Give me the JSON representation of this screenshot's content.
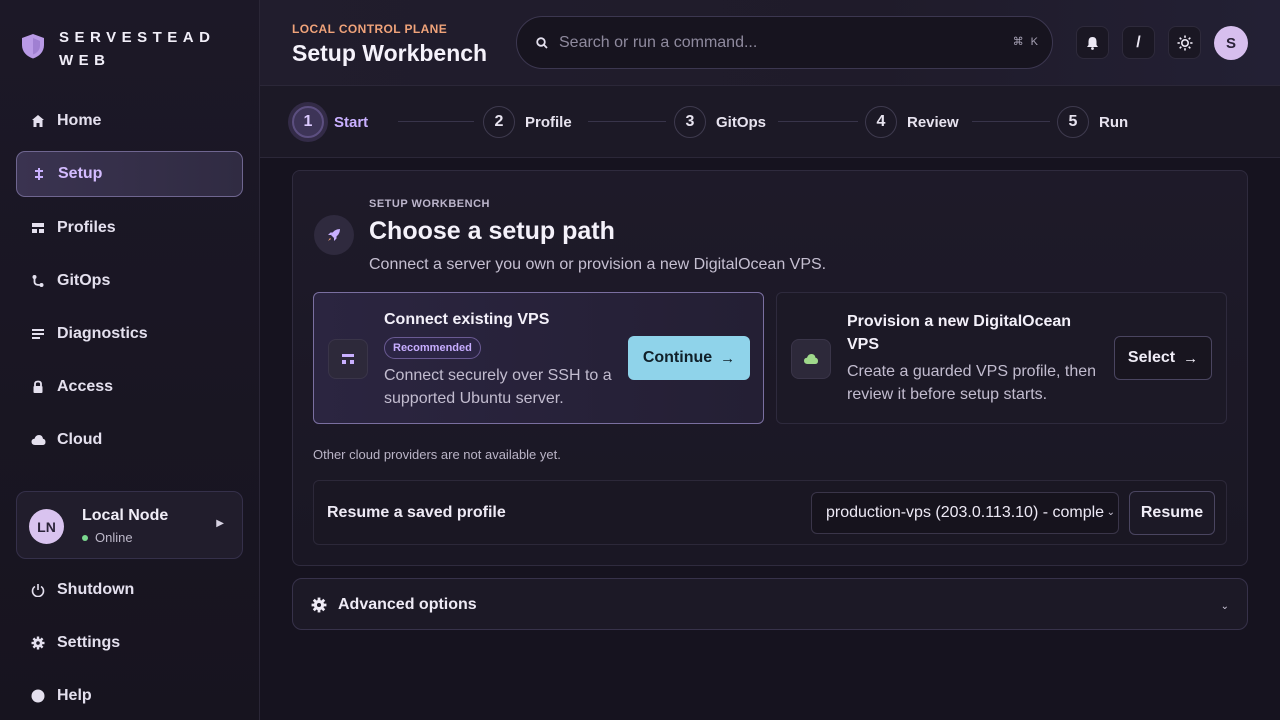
{
  "brand": {
    "name": "SERVESTEAD WEB",
    "logo_icon": "shield-logo-icon"
  },
  "sidebar": {
    "items": [
      {
        "label": "Home",
        "icon": "home-icon"
      },
      {
        "label": "Setup",
        "icon": "setup-icon",
        "active": true
      },
      {
        "label": "Profiles",
        "icon": "profiles-icon"
      },
      {
        "label": "GitOps",
        "icon": "gitops-icon"
      },
      {
        "label": "Diagnostics",
        "icon": "diagnostics-icon"
      },
      {
        "label": "Access",
        "icon": "lock-icon"
      },
      {
        "label": "Cloud",
        "icon": "cloud-icon"
      }
    ],
    "node": {
      "initials": "LN",
      "name": "Local Node",
      "status": "Online"
    },
    "footer_items": [
      {
        "label": "Shutdown",
        "icon": "power-icon"
      },
      {
        "label": "Settings",
        "icon": "gear-icon"
      },
      {
        "label": "Help",
        "icon": "help-icon"
      }
    ]
  },
  "header": {
    "eyebrow": "LOCAL CONTROL PLANE",
    "title": "Setup Workbench",
    "search_placeholder": "Search or run a command...",
    "shortcut": "⌘ K",
    "slash_label": "/",
    "avatar_initial": "S"
  },
  "stepper": {
    "steps": [
      {
        "num": "1",
        "label": "Start",
        "active": true
      },
      {
        "num": "2",
        "label": "Profile"
      },
      {
        "num": "3",
        "label": "GitOps"
      },
      {
        "num": "4",
        "label": "Review"
      },
      {
        "num": "5",
        "label": "Run"
      }
    ]
  },
  "panel": {
    "eyebrow": "SETUP WORKBENCH",
    "title": "Choose a setup path",
    "description": "Connect a server you own or provision a new DigitalOcean VPS.",
    "options": [
      {
        "title": "Connect existing VPS",
        "badge": "Recommended",
        "description_line1": "Connect securely over SSH to a",
        "description_line2": "supported Ubuntu server.",
        "button": "Continue"
      },
      {
        "title_line1": "Provision a new DigitalOcean",
        "title_line2": "VPS",
        "description_line1": "Create a guarded VPS profile, then",
        "description_line2": "review it before setup starts.",
        "button": "Select"
      }
    ],
    "note": "Other cloud providers are not available yet.",
    "resume": {
      "label": "Resume a saved profile",
      "selected": "production-vps (203.0.113.10) - comple",
      "button": "Resume"
    }
  },
  "advanced": {
    "label": "Advanced options"
  },
  "colors": {
    "accent": "#c9b0ff",
    "eyebrow": "#f0a37a",
    "continue_button": "#8fd3ea",
    "online": "#7bd88f"
  }
}
